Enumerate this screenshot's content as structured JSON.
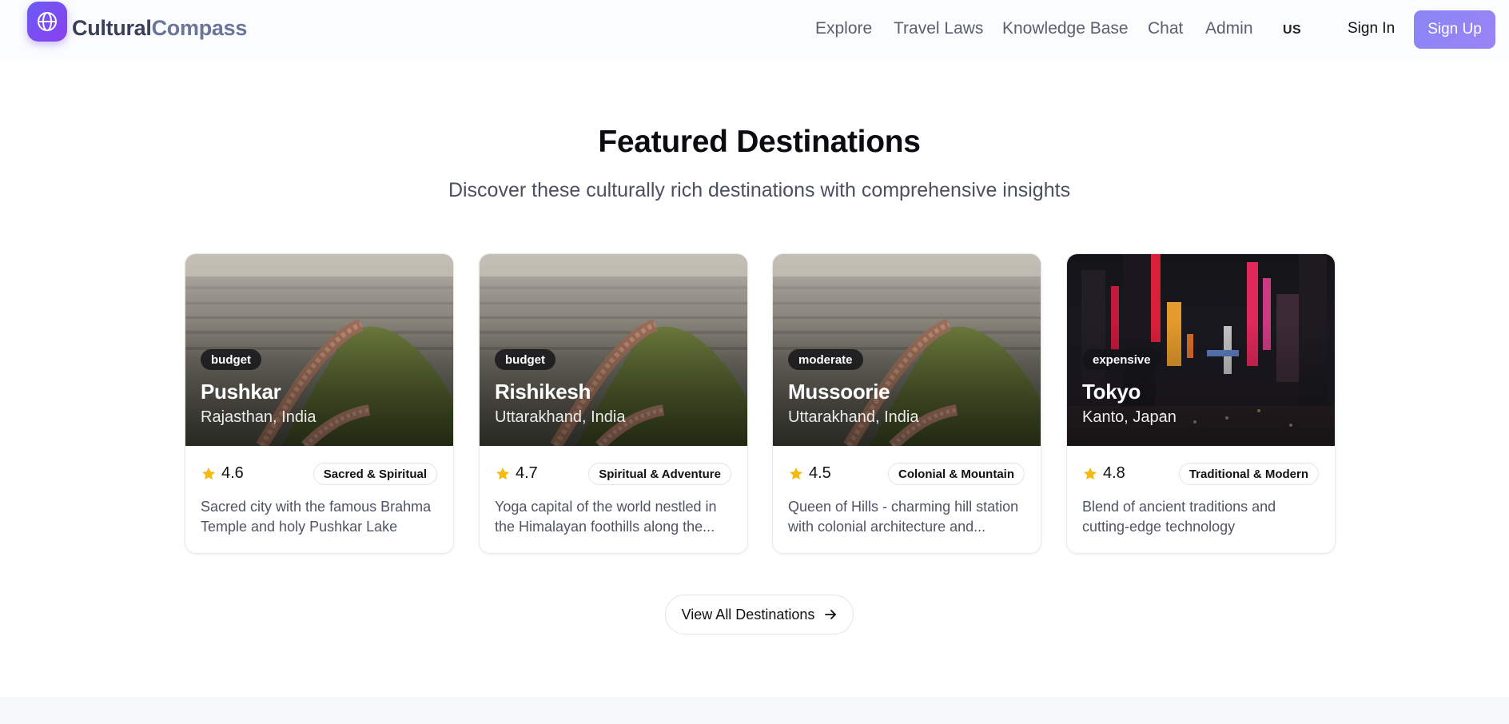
{
  "header": {
    "brand_part1": "Cultural",
    "brand_part2": "Compass",
    "nav": [
      "Explore",
      "Travel Laws",
      "Knowledge Base",
      "Chat",
      "Admin"
    ],
    "locale": "US",
    "sign_in": "Sign In",
    "sign_up": "Sign Up"
  },
  "section": {
    "title": "Featured Destinations",
    "subtitle": "Discover these culturally rich destinations with comprehensive insights"
  },
  "cards": [
    {
      "badge": "budget",
      "name": "Pushkar",
      "region": "Rajasthan, India",
      "rating": "4.6",
      "tag": "Sacred & Spiritual",
      "description": "Sacred city with the famous Brahma Temple and holy Pushkar Lake",
      "image": "city-fort"
    },
    {
      "badge": "budget",
      "name": "Rishikesh",
      "region": "Uttarakhand, India",
      "rating": "4.7",
      "tag": "Spiritual & Adventure",
      "description": "Yoga capital of the world nestled in the Himalayan foothills along the...",
      "image": "city-fort"
    },
    {
      "badge": "moderate",
      "name": "Mussoorie",
      "region": "Uttarakhand, India",
      "rating": "4.5",
      "tag": "Colonial & Mountain",
      "description": "Queen of Hills - charming hill station with colonial architecture and...",
      "image": "city-fort"
    },
    {
      "badge": "expensive",
      "name": "Tokyo",
      "region": "Kanto, Japan",
      "rating": "4.8",
      "tag": "Traditional & Modern",
      "description": "Blend of ancient traditions and cutting-edge technology",
      "image": "neon-street"
    }
  ],
  "cta": {
    "label": "View All Destinations",
    "icon": "arrow-right-icon"
  },
  "colors": {
    "accent": "#8a86f5",
    "logo": "#6a5cf2",
    "star": "#f5b90f"
  }
}
